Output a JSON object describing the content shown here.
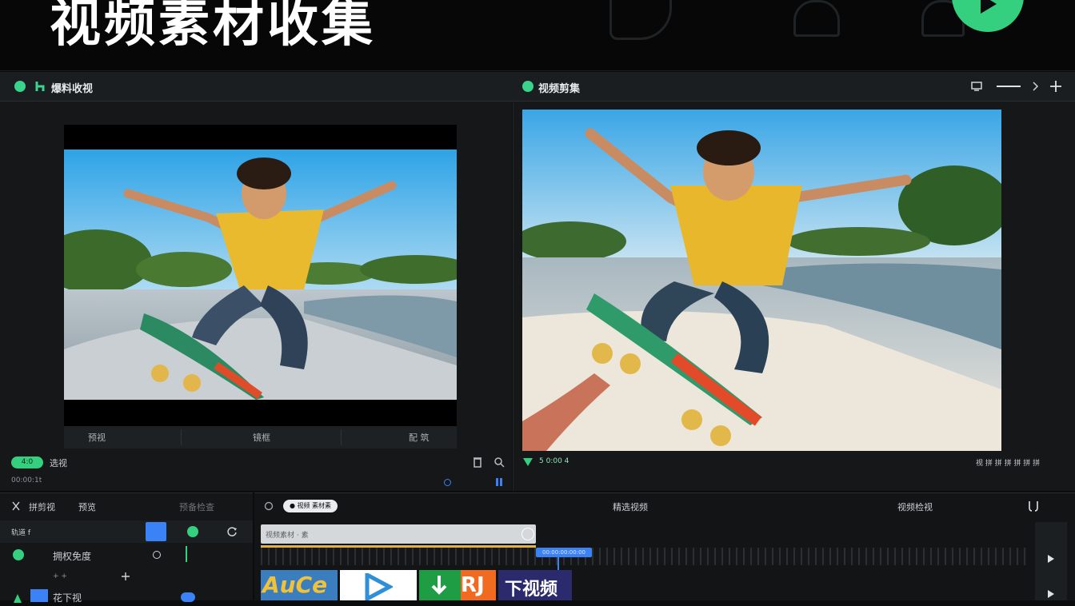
{
  "banner": {
    "title": "视频素材收集"
  },
  "appbar": {
    "left_title": "爆料收视",
    "right_title": "视频剪集"
  },
  "left_preview": {
    "controls": [
      "预视",
      "镜框",
      "配 筑"
    ],
    "status_pill": "4:0",
    "status_text": "选视",
    "timecode": "00:00:1t"
  },
  "right_preview": {
    "status": "5 0:00 4",
    "right_tools": "视 拼 拼 拼 拼 拼 拼"
  },
  "timeline_sidebar": {
    "tabs": [
      "拼剪视",
      "预览",
      "预备检查"
    ],
    "track_header": "轨道 f",
    "track1_label": "拥权免度",
    "track1_sub": "+ +",
    "track2_label": "花下视"
  },
  "timeline": {
    "clip_chip": "● 视频 素材素",
    "center_label": "精选视频",
    "right_label": "视频检视",
    "strip_label": "视频素材 · 素",
    "playhead_label": "00:00:00:00:00",
    "thumbs": [
      "AuCe",
      "",
      "",
      "RJ",
      "下视频"
    ]
  },
  "colors": {
    "accent_green": "#35d07f",
    "accent_blue": "#3b82f6",
    "panel_bg": "#151719"
  }
}
